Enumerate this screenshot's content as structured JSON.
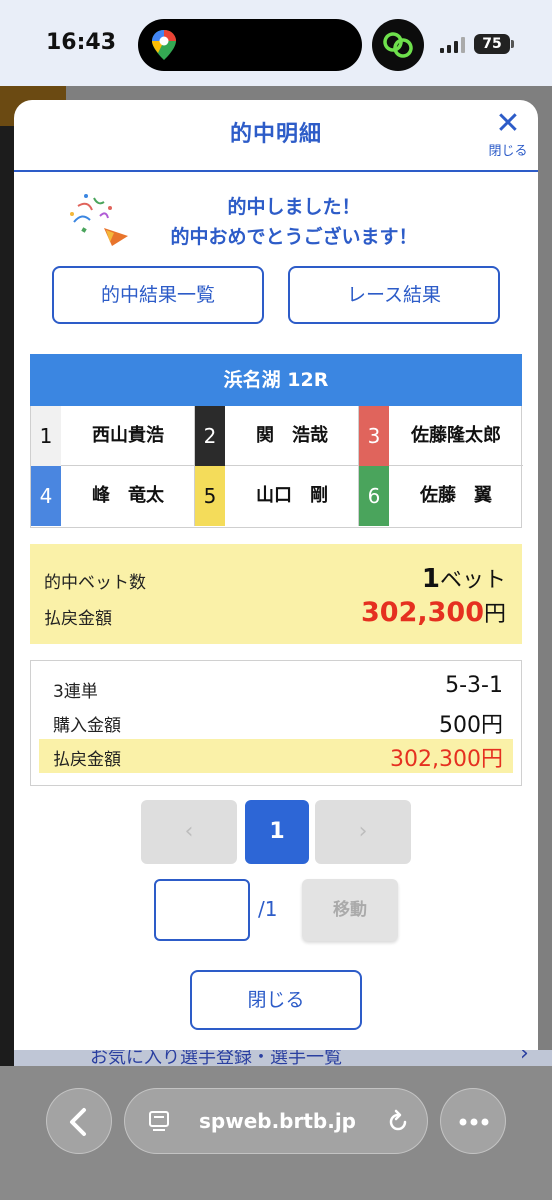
{
  "status": {
    "time": "16:43",
    "battery": "75"
  },
  "background": {
    "link_text": "お気に入り選手登録・選手一覧"
  },
  "modal": {
    "title": "的中明細",
    "close_label": "閉じる",
    "hit_line1": "的中しました！",
    "hit_line2": "的中おめでとうございます！",
    "btn_hit_list": "的中結果一覧",
    "btn_race_result": "レース結果",
    "race_header": "浜名湖 12R",
    "racers": [
      {
        "num": "1",
        "name": "西山貴浩",
        "color": "#f1f1f1",
        "text_color": "#111111"
      },
      {
        "num": "2",
        "name": "関　浩哉",
        "color": "#2b2b2b",
        "text_color": "#ffffff"
      },
      {
        "num": "3",
        "name": "佐藤隆太郎",
        "color": "#e0645c",
        "text_color": "#ffffff"
      },
      {
        "num": "4",
        "name": "峰　竜太",
        "color": "#4a86e0",
        "text_color": "#ffffff"
      },
      {
        "num": "5",
        "name": "山口　剛",
        "color": "#f4dc5a",
        "text_color": "#111111"
      },
      {
        "num": "6",
        "name": "佐藤　翼",
        "color": "#4aa45c",
        "text_color": "#ffffff"
      }
    ],
    "summary": {
      "bet_count_label": "的中ベット数",
      "bet_count": "1",
      "bet_unit": "ベット",
      "payout_label": "払戻金額",
      "payout": "302,300",
      "yen": "円"
    },
    "detail": {
      "bet_type": "3連単",
      "combination": "5-3-1",
      "purchase_label": "購入金額",
      "purchase_amount": "500円",
      "payout_label": "払戻金額",
      "payout_amount": "302,300円"
    },
    "pagination": {
      "prev": "‹",
      "current": "1",
      "next": "›",
      "input_value": "",
      "total": "/1",
      "move_label": "移動"
    },
    "close_button": "閉じる"
  },
  "browser": {
    "url": "spweb.brtb.jp"
  }
}
